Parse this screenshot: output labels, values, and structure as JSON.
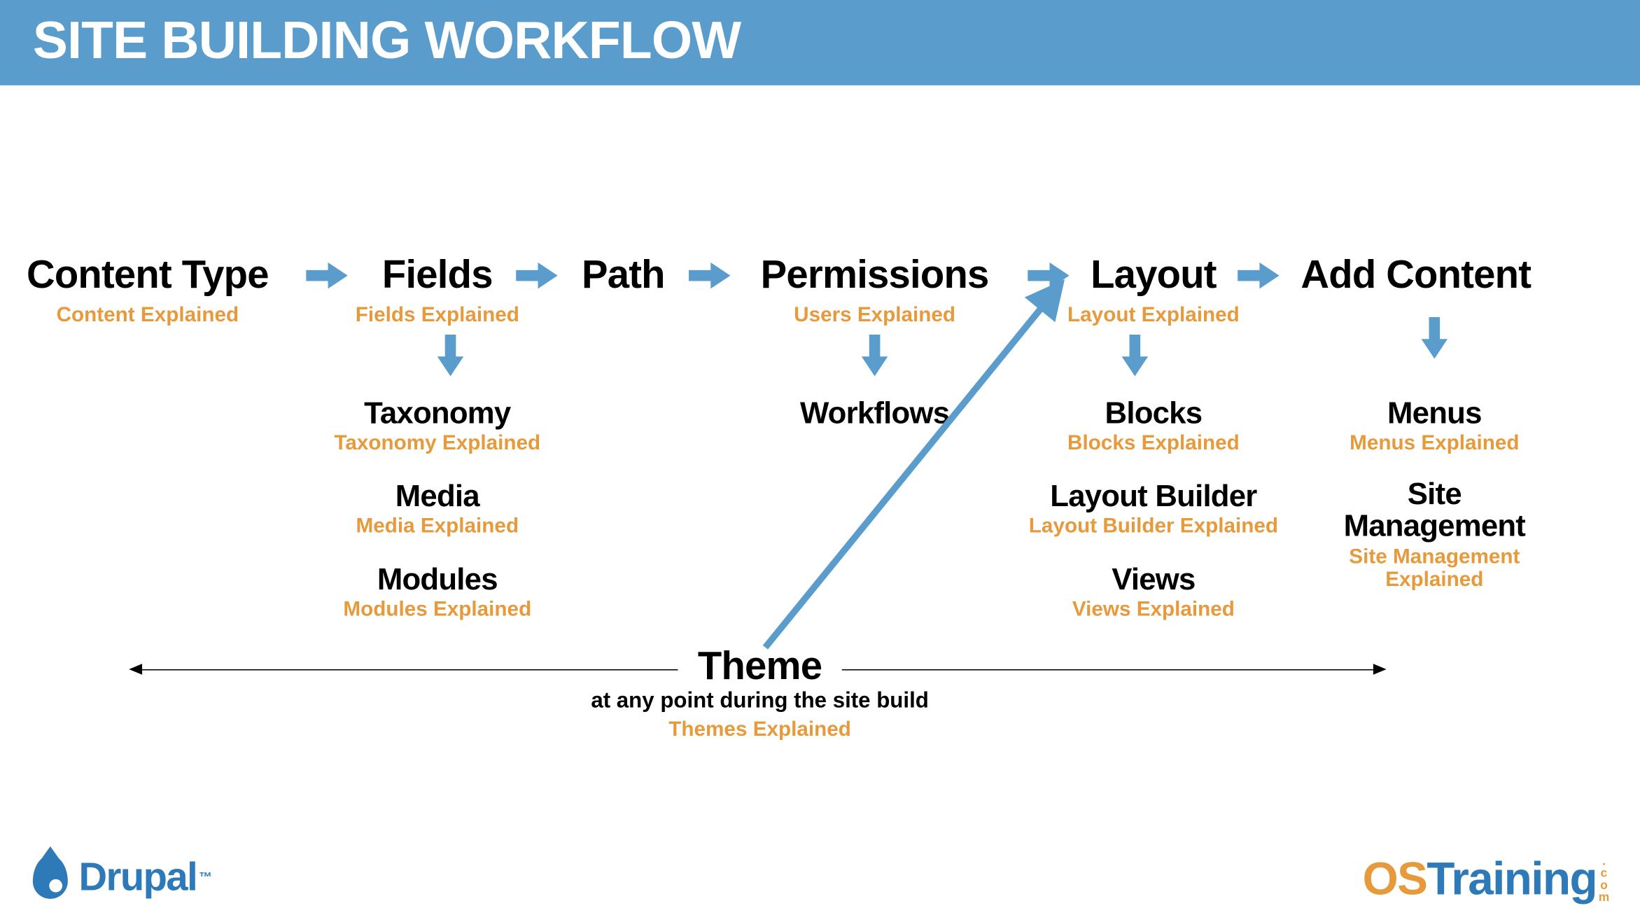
{
  "title": "SITE BUILDING WORKFLOW",
  "steps": {
    "content_type": {
      "label": "Content Type",
      "sub": "Content Explained"
    },
    "fields": {
      "label": "Fields",
      "sub": "Fields Explained"
    },
    "path": {
      "label": "Path"
    },
    "permissions": {
      "label": "Permissions",
      "sub": "Users Explained"
    },
    "layout": {
      "label": "Layout",
      "sub": "Layout Explained"
    },
    "add_content": {
      "label": "Add Content"
    }
  },
  "fields_children": {
    "taxonomy": {
      "label": "Taxonomy",
      "sub": "Taxonomy Explained"
    },
    "media": {
      "label": "Media",
      "sub": "Media Explained"
    },
    "modules": {
      "label": "Modules",
      "sub": "Modules Explained"
    }
  },
  "permissions_children": {
    "workflows": {
      "label": "Workflows"
    }
  },
  "layout_children": {
    "blocks": {
      "label": "Blocks",
      "sub": "Blocks Explained"
    },
    "layout_builder": {
      "label": "Layout Builder",
      "sub": "Layout Builder Explained"
    },
    "views": {
      "label": "Views",
      "sub": "Views Explained"
    }
  },
  "add_content_children": {
    "menus": {
      "label": "Menus",
      "sub": "Menus Explained"
    },
    "site_management": {
      "label": "Site\nManagement",
      "sub": "Site Management Explained"
    }
  },
  "theme": {
    "label": "Theme",
    "note": "at any point during the site build",
    "sub": "Themes Explained"
  },
  "footer": {
    "drupal": "Drupal",
    "drupal_tm": "™",
    "ost_os": "OS",
    "ost_training": "Training",
    "ost_com": ".com"
  }
}
